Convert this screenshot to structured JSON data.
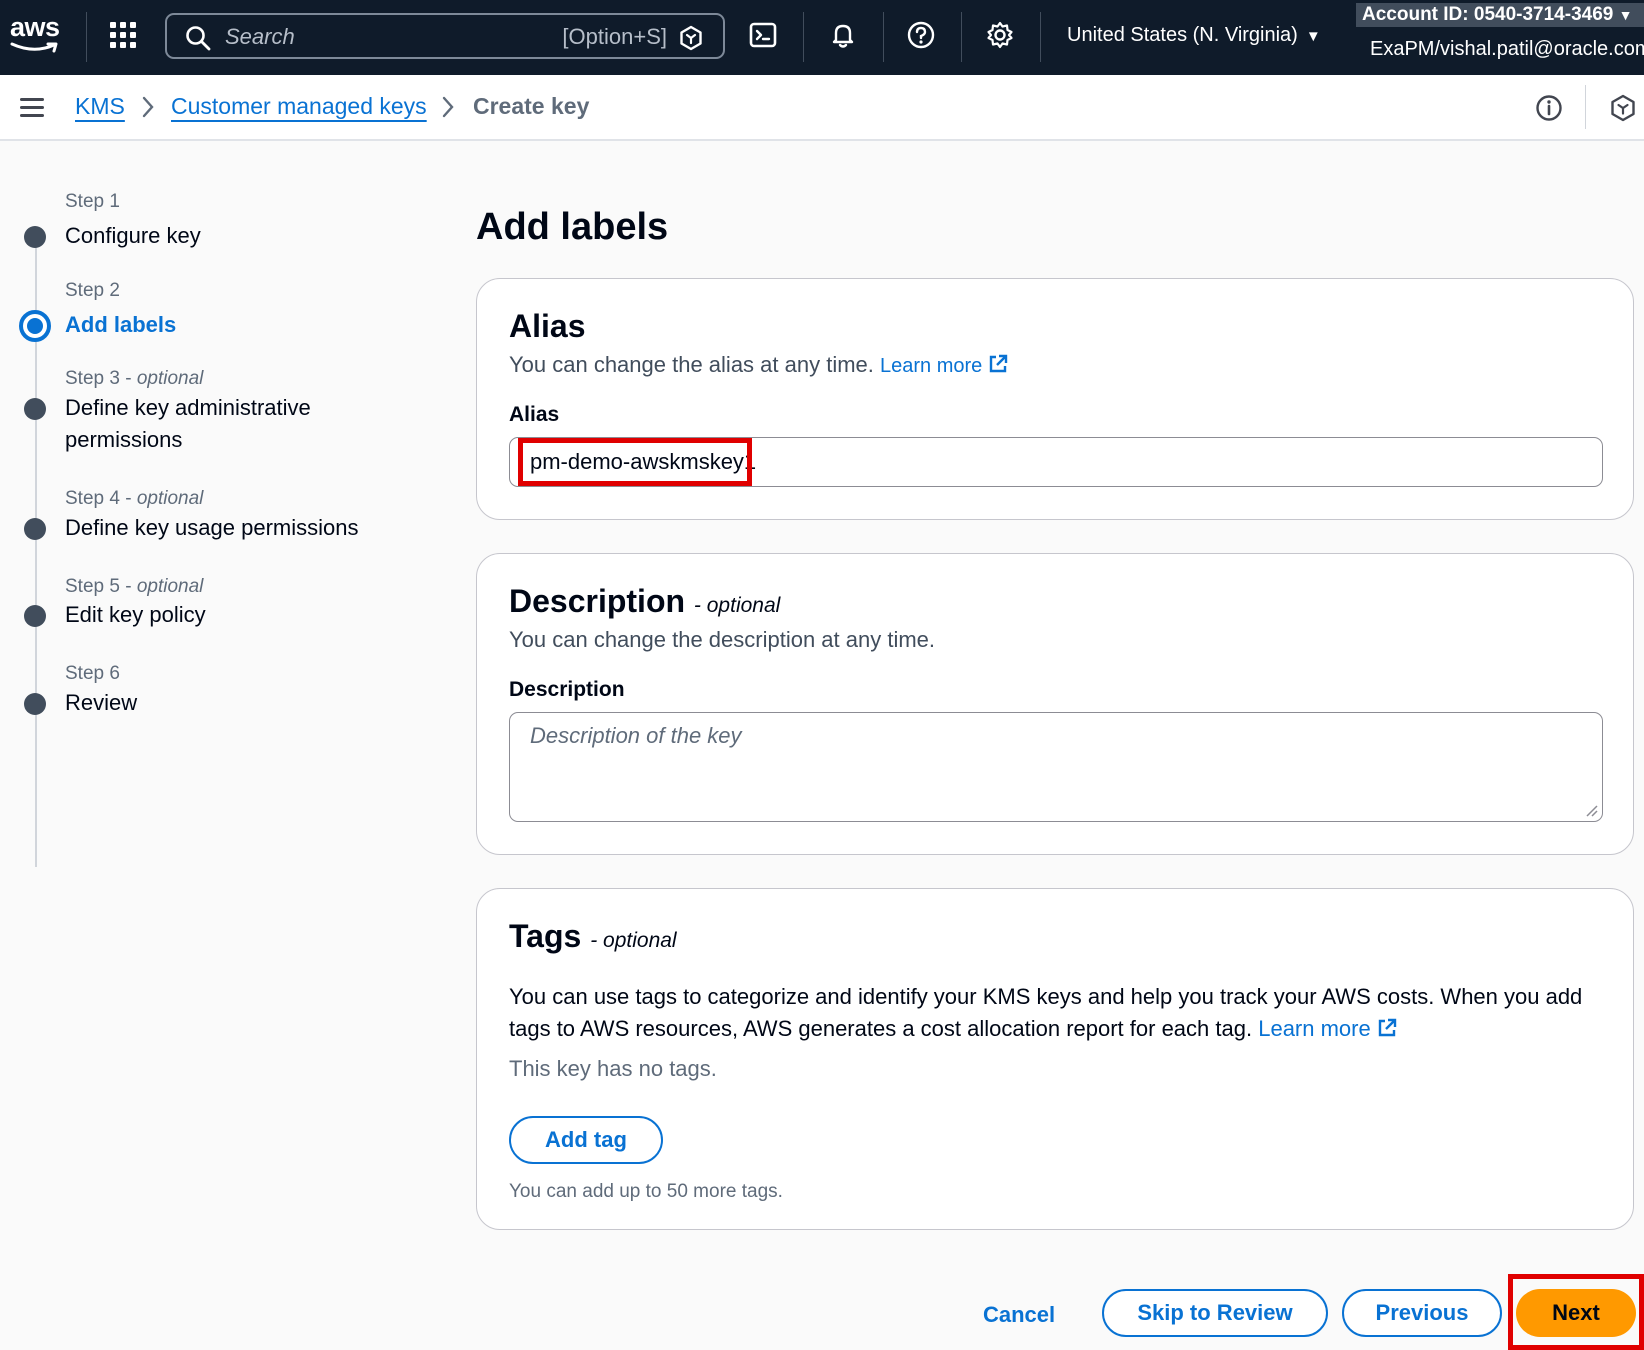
{
  "topnav": {
    "logo_text": "aws",
    "search_placeholder": "Search",
    "search_shortcut": "[Option+S]",
    "region": "United States (N. Virginia)",
    "account": "Account ID: 0540-3714-3469",
    "user": "ExaPM/vishal.patil@oracle.com",
    "icons": [
      "services-grid-icon",
      "search-icon",
      "amazon-q-icon",
      "cloudshell-icon",
      "bell-icon",
      "help-icon",
      "gear-icon"
    ]
  },
  "breadcrumb": {
    "items": [
      "KMS",
      "Customer managed keys"
    ],
    "current": "Create key"
  },
  "steps": [
    {
      "label": "Step 1",
      "optional": "",
      "title": "Configure key"
    },
    {
      "label": "Step 2",
      "optional": "",
      "title": "Add labels"
    },
    {
      "label": "Step 3",
      "optional": "optional",
      "title": "Define key administrative permissions"
    },
    {
      "label": "Step 4",
      "optional": "optional",
      "title": "Define key usage permissions"
    },
    {
      "label": "Step 5",
      "optional": "optional",
      "title": "Edit key policy"
    },
    {
      "label": "Step 6",
      "optional": "",
      "title": "Review"
    }
  ],
  "main": {
    "title": "Add labels",
    "alias": {
      "heading": "Alias",
      "description": "You can change the alias at any time.",
      "learn_more": "Learn more",
      "field_label": "Alias",
      "value": "pm-demo-awskmskey1"
    },
    "description": {
      "heading": "Description",
      "optional": "- optional",
      "description": "You can change the description at any time.",
      "field_label": "Description",
      "placeholder": "Description of the key"
    },
    "tags": {
      "heading": "Tags",
      "optional": "- optional",
      "body": "You can use tags to categorize and identify your KMS keys and help you track your AWS costs. When you add tags to AWS resources, AWS generates a cost allocation report for each tag.",
      "learn_more": "Learn more",
      "empty": "This key has no tags.",
      "add_button": "Add tag",
      "limit": "You can add up to 50 more tags."
    }
  },
  "footer": {
    "cancel": "Cancel",
    "skip": "Skip to Review",
    "previous": "Previous",
    "next": "Next"
  },
  "colors": {
    "nav_bg": "#0f1b2a",
    "link": "#0972d3",
    "primary": "#ff9900",
    "highlight": "#e00000"
  }
}
